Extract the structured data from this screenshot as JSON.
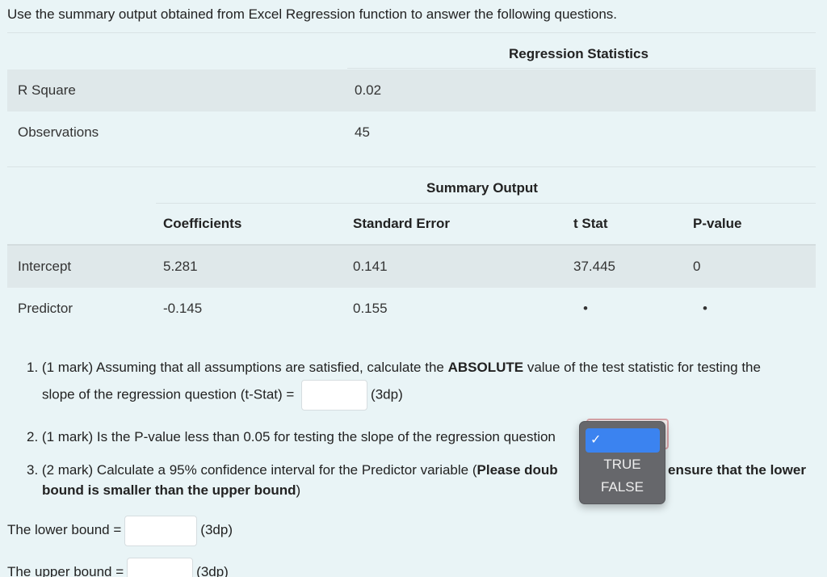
{
  "intro": "Use the summary output obtained from Excel Regression function to answer the following questions.",
  "regression_statistics": {
    "caption": "Regression Statistics",
    "rows": [
      {
        "label": "R Square",
        "value": "0.02"
      },
      {
        "label": "Observations",
        "value": "45"
      }
    ]
  },
  "summary_output": {
    "caption": "Summary Output",
    "headers": [
      "",
      "Coefficients",
      "Standard Error",
      "t Stat",
      "P-value"
    ],
    "rows": [
      {
        "label": "Intercept",
        "coef": "5.281",
        "se": "0.141",
        "tstat": "37.445",
        "pvalue": "0"
      },
      {
        "label": "Predictor",
        "coef": "-0.145",
        "se": "0.155",
        "tstat": "•",
        "pvalue": "•"
      }
    ]
  },
  "questions": {
    "q1": {
      "num": "1.",
      "pre": "(1 mark) Assuming that all assumptions are satisfied, calculate the ",
      "bold": "ABSOLUTE",
      "post": " value of the test statistic for testing the",
      "line2": "slope of the regression question (t-Stat) = ",
      "suffix": "(3dp)"
    },
    "q2": {
      "num": "2.",
      "text": "(1 mark) Is the P-value less than 0.05 for testing the slope of the regression question"
    },
    "q3": {
      "num": "3.",
      "pre": "(2 mark) Calculate a 95% confidence interval for the Predictor variable (",
      "bold_left": "Please doub",
      "bold_right": "ensure that the lower",
      "bold_line2": "bound is smaller than the upper bound",
      "close": ")"
    }
  },
  "lower_bound": {
    "label": "The lower bound =",
    "suffix": "(3dp)"
  },
  "upper_bound": {
    "label": "The upper bound =",
    "suffix": "(3dp)"
  },
  "dropdown": {
    "selected_mark": "✓",
    "options": [
      "TRUE",
      "FALSE"
    ]
  },
  "colors": {
    "background": "#e9f4f6",
    "shaded_row": "#dfe8ea",
    "dropdown_bg": "#66676b",
    "dropdown_highlight": "#3b83f0"
  }
}
